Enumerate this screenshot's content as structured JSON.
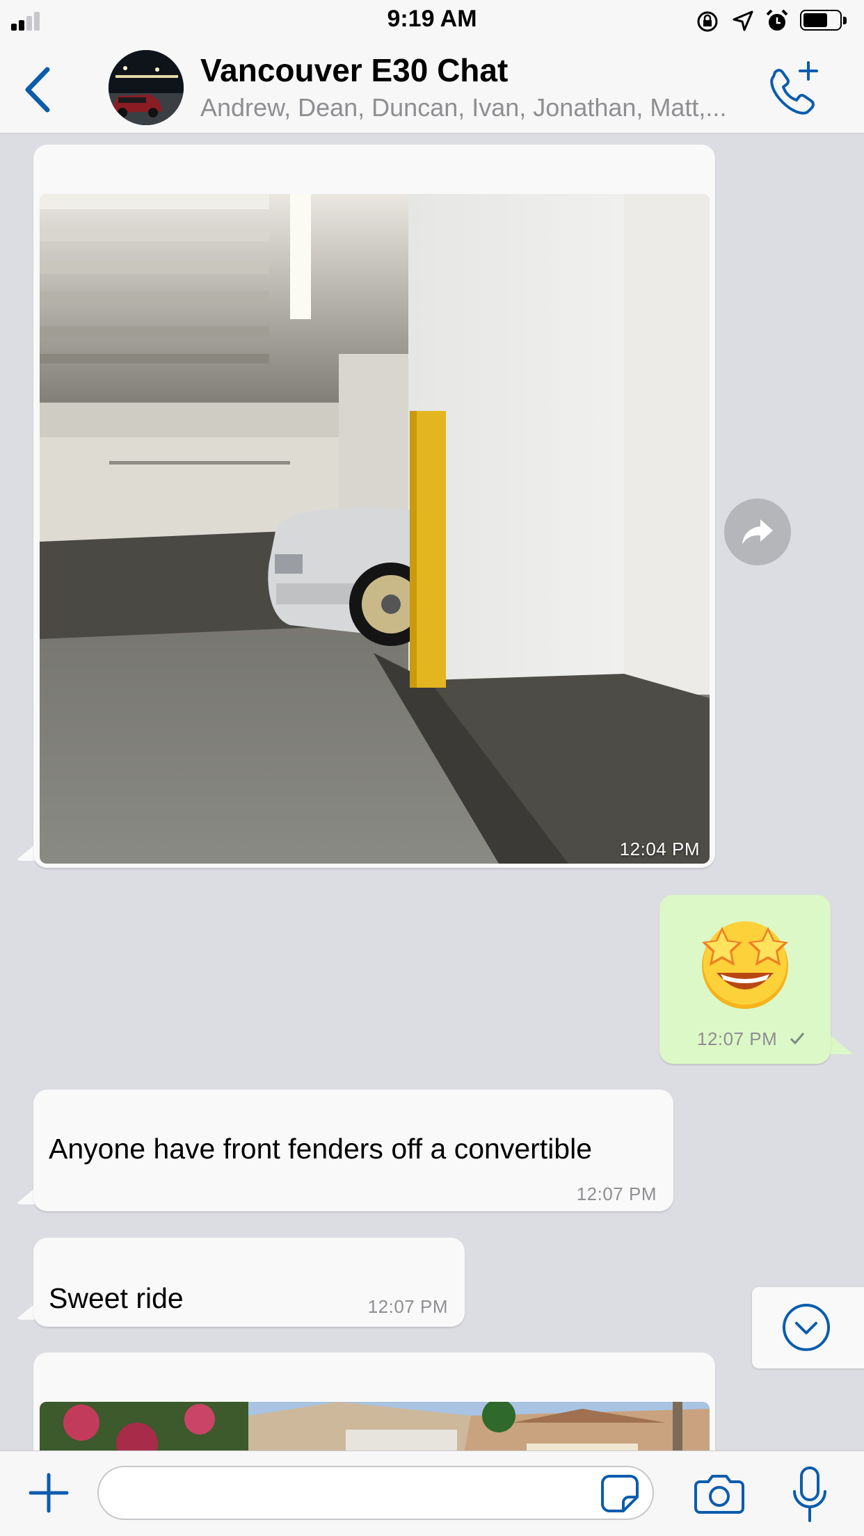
{
  "status_bar": {
    "time": "9:19 AM"
  },
  "header": {
    "title": "Vancouver E30 Chat",
    "subtitle": "Andrew, Dean, Duncan, Ivan, Jonathan, Matt,..."
  },
  "messages": [
    {
      "type": "image",
      "direction": "incoming",
      "time": "12:04 PM"
    },
    {
      "type": "emoji",
      "direction": "outgoing",
      "emoji": "🤩",
      "time": "12:07 PM",
      "status": "sent"
    },
    {
      "type": "text",
      "direction": "incoming",
      "text": "Anyone have front fenders off a convertible",
      "time": "12:07 PM"
    },
    {
      "type": "text",
      "direction": "incoming",
      "text": "Sweet ride",
      "time": "12:07 PM"
    },
    {
      "type": "image",
      "direction": "incoming",
      "time": ""
    }
  ],
  "composer": {
    "placeholder": ""
  },
  "colors": {
    "accent": "#0b5cad",
    "outgoing_bubble": "#dcf8c6",
    "incoming_bubble": "#f9f9f9",
    "background": "#dcdde2"
  },
  "icons": [
    "back-chevron-icon",
    "add-call-icon",
    "forward-icon",
    "scroll-down-icon",
    "plus-icon",
    "sticker-icon",
    "camera-icon",
    "microphone-icon",
    "checkmark-icon"
  ]
}
